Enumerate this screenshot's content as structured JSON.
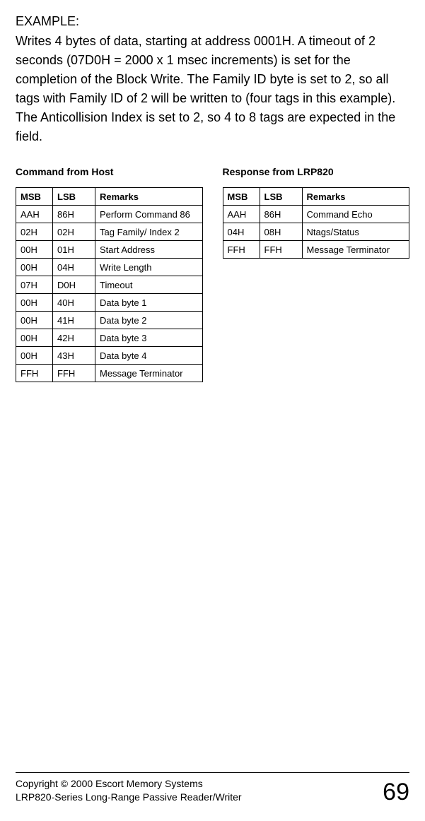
{
  "example_label": "EXAMPLE:",
  "example_body": "Writes 4 bytes of data, starting at address 0001H. A timeout of 2 seconds (07D0H = 2000 x 1 msec increments) is set for the completion of the Block Write.  The Family ID byte is set to 2, so all tags with Family ID of 2 will be written to (four tags in this example).  The Anticollision Index is set to 2, so 4 to 8 tags are expected in the field.",
  "left_title": "Command from Host",
  "right_title": "Response from LRP820",
  "headers": {
    "msb": "MSB",
    "lsb": "LSB",
    "remarks": "Remarks"
  },
  "left_rows": [
    {
      "msb": "AAH",
      "lsb": "86H",
      "remarks": "Perform Command 86"
    },
    {
      "msb": "02H",
      "lsb": "02H",
      "remarks": "Tag Family/ Index 2"
    },
    {
      "msb": "00H",
      "lsb": "01H",
      "remarks": "Start Address"
    },
    {
      "msb": "00H",
      "lsb": "04H",
      "remarks": "Write Length"
    },
    {
      "msb": "07H",
      "lsb": "D0H",
      "remarks": "Timeout"
    },
    {
      "msb": "00H",
      "lsb": "40H",
      "remarks": "Data byte 1"
    },
    {
      "msb": "00H",
      "lsb": "41H",
      "remarks": "Data byte 2"
    },
    {
      "msb": "00H",
      "lsb": "42H",
      "remarks": "Data byte 3"
    },
    {
      "msb": "00H",
      "lsb": "43H",
      "remarks": "Data byte 4"
    },
    {
      "msb": "FFH",
      "lsb": "FFH",
      "remarks": "Message Terminator"
    }
  ],
  "right_rows": [
    {
      "msb": "AAH",
      "lsb": "86H",
      "remarks": "Command Echo"
    },
    {
      "msb": "04H",
      "lsb": "08H",
      "remarks": "Ntags/Status"
    },
    {
      "msb": "FFH",
      "lsb": "FFH",
      "remarks": "Message Terminator"
    }
  ],
  "footer": {
    "line1": "Copyright © 2000 Escort Memory Systems",
    "line2": "LRP820-Series Long-Range Passive Reader/Writer",
    "page": "69"
  }
}
